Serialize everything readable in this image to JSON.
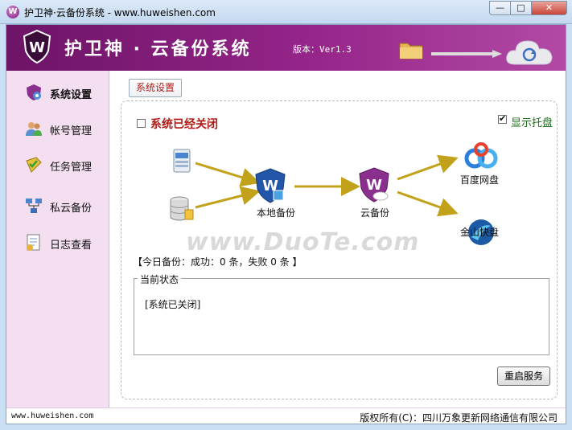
{
  "window": {
    "title": "护卫神·云备份系统 - www.huweishen.com"
  },
  "banner": {
    "brand": "护卫神 · 云备份系统",
    "version": "版本：Ver1.3"
  },
  "sidebar": {
    "items": [
      {
        "label": "系统设置",
        "icon": "settings-icon",
        "active": true
      },
      {
        "label": "帐号管理",
        "icon": "users-icon"
      },
      {
        "label": "任务管理",
        "icon": "tasks-icon"
      },
      {
        "label": "私云备份",
        "icon": "network-icon"
      },
      {
        "label": "日志查看",
        "icon": "log-icon"
      }
    ]
  },
  "tab": {
    "label": "系统设置"
  },
  "settings": {
    "system_status": "系统已经关闭",
    "system_enabled": false,
    "show_tray": "显示托盘",
    "show_tray_checked": true
  },
  "flow": {
    "local_backup": "本地备份",
    "cloud_backup": "云备份",
    "baidu": "百度网盘",
    "kingsoft": "金山快盘"
  },
  "today": "【今日备份：成功：0 条，失败 0 条 】",
  "current_status": {
    "legend": "当前状态",
    "text": "[系统已关闭]"
  },
  "restart_button": "重启服务",
  "footer": {
    "site": "www.huweishen.com",
    "copyright": "版权所有(C)：四川万象更新网络通信有限公司"
  },
  "watermark": "www.DuoTe.com",
  "colors": {
    "brand": "#96258a",
    "status_red": "#b01a14",
    "tray_green": "#176b17"
  }
}
